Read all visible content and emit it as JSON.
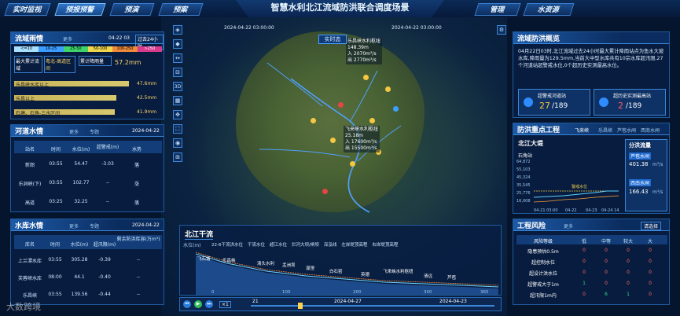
{
  "topnav": {
    "tabs_left": [
      "实时监视",
      "预报预警",
      "预演",
      "预案"
    ],
    "title": "智慧水利北江流域防洪联合调度场景",
    "tabs_right": [
      "管理",
      "水资源"
    ]
  },
  "timebar": {
    "left_time": "2024-04-22 03:00:00",
    "right_time": "2024-04-22 03:00:00",
    "mode": "实时态"
  },
  "rain": {
    "title": "流域雨情",
    "more": "更多",
    "date": "04-22 03",
    "range": "过去24小时",
    "legend": [
      "<=10",
      "10-25",
      "25-50",
      "50-100",
      "100-250",
      ">250"
    ],
    "headers": [
      "最大累计流域",
      "粤北-高道区间",
      "累计降雨量",
      "57.2mm"
    ],
    "rows": [
      {
        "name": "乐昌峡水库以上",
        "value": "47.6mm",
        "pct": 0.83
      },
      {
        "name": "乐昌以上",
        "value": "42.5mm",
        "pct": 0.74
      },
      {
        "name": "石塘、石角-三水区间",
        "value": "41.9mm",
        "pct": 0.73
      }
    ]
  },
  "river": {
    "title": "河道水情",
    "more": "更多",
    "tag": "专题",
    "date": "2024-04-22",
    "cols": [
      "站名",
      "时间",
      "水位(m)",
      "超警戒(m)",
      "水势"
    ],
    "rows": [
      [
        "新韶",
        "03:55",
        "54.47",
        "-3.03",
        "落"
      ],
      [
        "乐洞峡(下)",
        "03:55",
        "102.77",
        "--",
        "涨"
      ],
      [
        "高道",
        "03:25",
        "32.25",
        "--",
        "落"
      ]
    ]
  },
  "reservoir": {
    "title": "水库水情",
    "more": "更多",
    "tag": "专题",
    "date": "2024-04-22",
    "cols": [
      "库名",
      "时间",
      "水位(m)",
      "超汛限(m)",
      "剩余防洪库容(万m³)"
    ],
    "rows": [
      [
        "上兰潭水库",
        "03:55",
        "305.28",
        "-0.39",
        "--"
      ],
      [
        "芙蓉峡水库",
        "08:00",
        "44.1",
        "-0.40",
        "--"
      ],
      [
        "乐昌峡",
        "03:55",
        "139.56",
        "-0.44",
        "--"
      ]
    ]
  },
  "overview": {
    "title": "流域防洪概览",
    "text": "04月22日03时,北江流域过去24小时最大累计降雨站点为鱼水大坡水库,降雨量为129.5mm,当前大中型水库共有10宗水库超汛限,27个河道站超警戒水位,0个超历史实测最高水位。",
    "stat1_label": "超警戒河道站",
    "stat1_value": "27",
    "stat1_total": "/189",
    "stat2_label": "超历史实测最高站",
    "stat2_value": "2",
    "stat2_total": "/189"
  },
  "project": {
    "title": "防洪重点工程",
    "tabs": [
      "飞来峡",
      "乐昌峡",
      "芦苞水闸",
      "西南水闸"
    ],
    "sub": "北江大堤",
    "station": "石角站",
    "unit_y": "水位(m)",
    "chart_labels": [
      "64,872",
      "55,103",
      "45,324",
      "35,545",
      "25,776",
      "16,008"
    ],
    "x_labels": [
      "04-21 03:00",
      "04-22",
      "04-23",
      "04-24 14"
    ],
    "annot": "警戒水位",
    "flow_title": "分洪流量",
    "flow1_label": "芦苞水闸",
    "flow1_value": "401.38",
    "flow2_label": "西南水闸",
    "flow2_value": "166.43",
    "flow_unit": "m³/s"
  },
  "risk": {
    "title": "工程风险",
    "more": "更多",
    "filter": "请选择",
    "cols": [
      "风险等级",
      "低",
      "中等",
      "较大",
      "大"
    ],
    "rows": [
      [
        "隐患预估0.5m",
        "0",
        "0",
        "0",
        "0"
      ],
      [
        "超控制水位",
        "0",
        "0",
        "0",
        "0"
      ],
      [
        "超设计洪水位",
        "0",
        "0",
        "0",
        "0"
      ],
      [
        "超警戒大于1m",
        "1",
        "0",
        "0",
        "0"
      ],
      [
        "超汛限1m内",
        "0",
        "6",
        "1",
        "0"
      ]
    ]
  },
  "section": {
    "title": "北江干流",
    "legend": [
      "22-6干流洪水位",
      "干流水位",
      "超江水位",
      "拦河大坝/闸坝",
      "深泓线",
      "左岸堤顶高程",
      "右岸堤顶高程"
    ],
    "places": [
      "飞石塘",
      "乐昌峡",
      "清头水利",
      "孟洲坝",
      "濛浬",
      "白石窑",
      "英德",
      "飞来峡水利枢纽",
      "清远",
      "芦苞"
    ],
    "y_label": "水位(m)",
    "x_ticks": [
      "0",
      "100",
      "200",
      "300",
      "365"
    ]
  },
  "timeline": {
    "speed": "×1",
    "start": "2024-04-27",
    "end": "2024-04-23",
    "pos": "21"
  },
  "map_labels": [
    {
      "text": "乐昌峡水利枢纽\n148.39m\n入 2070m³/s\n出 2770m³/s"
    },
    {
      "text": "飞来峡水利枢纽\n25.18m\n入 17600m³/s\n出 15500m³/s"
    }
  ],
  "watermark": "大数跨境"
}
